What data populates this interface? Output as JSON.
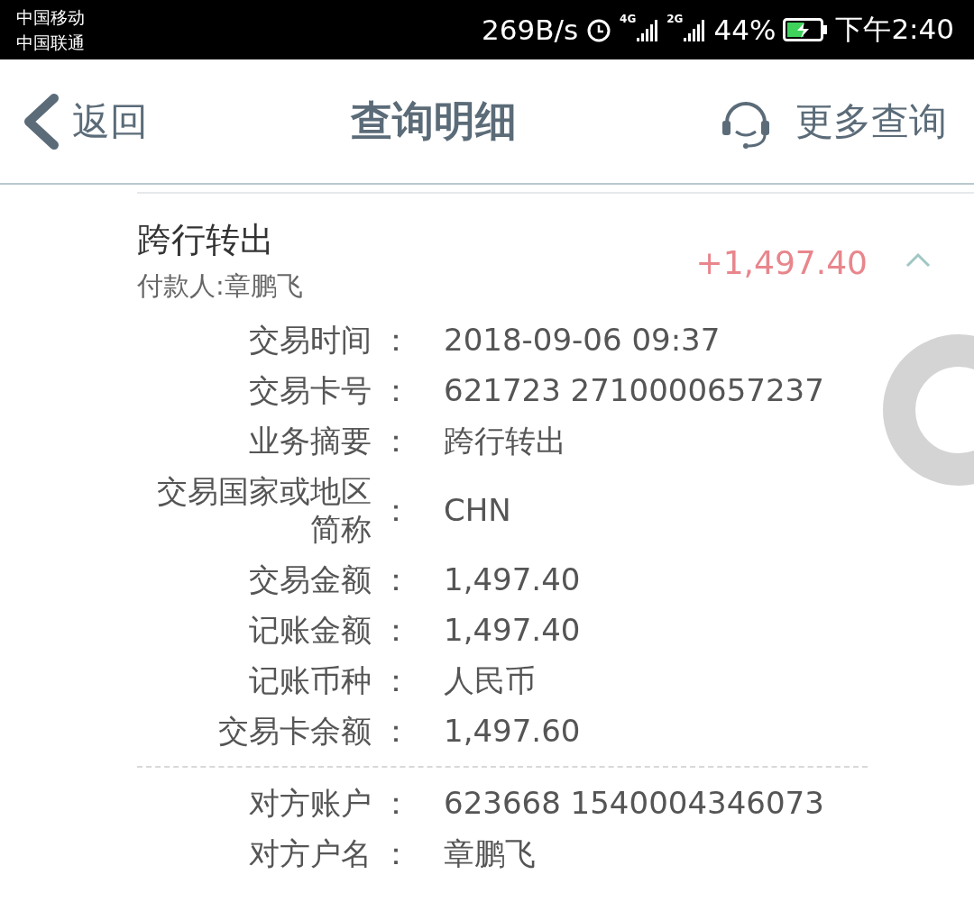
{
  "status_bar": {
    "carriers": [
      "中国移动",
      "中国联通"
    ],
    "speed": "269B/s",
    "networks": [
      "4G",
      "2G"
    ],
    "battery": "44%",
    "time": "下午2:40"
  },
  "header": {
    "back": "返回",
    "title": "查询明细",
    "more": "更多查询"
  },
  "transaction": {
    "title": "跨行转出",
    "payer": "付款人:章鹏飞",
    "amount": "+1,497.40",
    "expanded": true
  },
  "detail_groups": [
    {
      "rows": [
        {
          "label": "交易时间",
          "separator": "：",
          "value": "2018-09-06 09:37"
        },
        {
          "label": "交易卡号",
          "separator": "：",
          "value": "621723 2710000657237"
        },
        {
          "label": "业务摘要",
          "separator": "：",
          "value": "跨行转出"
        },
        {
          "label": "交易国家或地区简称",
          "separator": "：",
          "value": "CHN"
        },
        {
          "label": "交易金额",
          "separator": "：",
          "value": "1,497.40"
        },
        {
          "label": "记账金额",
          "separator": "：",
          "value": "1,497.40"
        },
        {
          "label": "记账币种",
          "separator": "：",
          "value": "人民币"
        },
        {
          "label": "交易卡余额",
          "separator": "：",
          "value": "1,497.60"
        }
      ]
    },
    {
      "rows": [
        {
          "label": "对方账户",
          "separator": "：",
          "value": "623668 1540004346073"
        },
        {
          "label": "对方户名",
          "separator": "：",
          "value": "章鹏飞"
        }
      ]
    }
  ]
}
